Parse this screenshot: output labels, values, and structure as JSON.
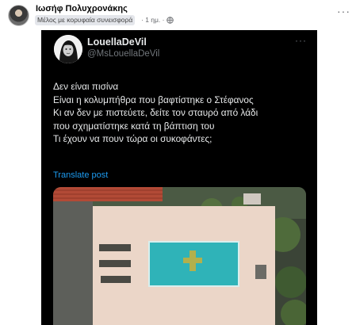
{
  "post": {
    "author": "Ιωσήφ Πολυχρονάκης",
    "badge": "Μέλος με κορυφαία συνεισφορά",
    "time": "· 1 ημ. ·",
    "more": "···"
  },
  "tweet": {
    "display_name": "LouellaDeVil",
    "handle": "@MsLouellaDeVil",
    "more": "···",
    "lines": [
      "Δεν είναι πισίνα",
      "Είναι η κολυμπήθρα που βαφτίστηκε ο Στέφανος",
      "Κι αν δεν με πιστεύετε, δείτε τον σταυρό από λάδι",
      "που σχηματίστηκε κατά τη βάπτιση του",
      "Τι έχουν να πουν τώρα οι συκοφάντες;"
    ],
    "translate": "Translate post"
  },
  "icons": {
    "globe": "globe-icon",
    "more": "more-options-icon"
  },
  "colors": {
    "tweet_bg": "#000000",
    "link_blue": "#1d9bf0",
    "pool_water": "#2fb3b8"
  }
}
